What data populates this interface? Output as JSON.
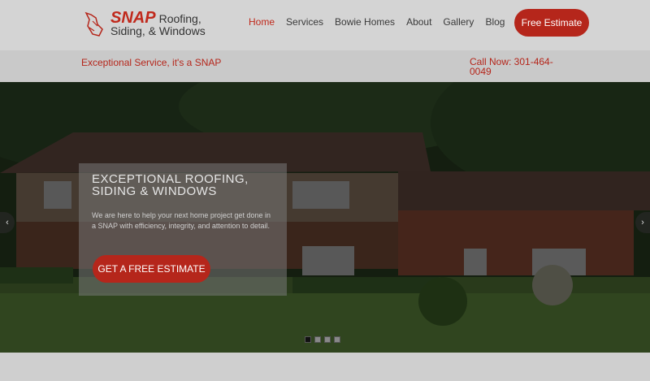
{
  "brand": {
    "name": "SNAP",
    "line1_rest": "Roofing,",
    "line2": "Siding, & Windows"
  },
  "nav": {
    "items": [
      {
        "label": "Home"
      },
      {
        "label": "Services"
      },
      {
        "label": "Bowie Homes"
      },
      {
        "label": "About"
      },
      {
        "label": "Gallery"
      },
      {
        "label": "Blog"
      }
    ],
    "cta_label": "Free Estimate"
  },
  "subbar": {
    "tagline": "Exceptional Service, it's a SNAP",
    "call": "Call Now: 301-464-0049"
  },
  "hero": {
    "title": "EXCEPTIONAL ROOFING, SIDING & WINDOWS",
    "text": "We are here to help your next home project get done in a SNAP with efficiency, integrity, and attention to detail.",
    "button": "GET A FREE ESTIMATE",
    "prev_icon": "chevron-left-icon",
    "next_icon": "chevron-right-icon",
    "slides_total": 4,
    "active_slide": 1
  },
  "colors": {
    "brand_red": "#b5261b",
    "header_bg": "#d4d4d4"
  }
}
